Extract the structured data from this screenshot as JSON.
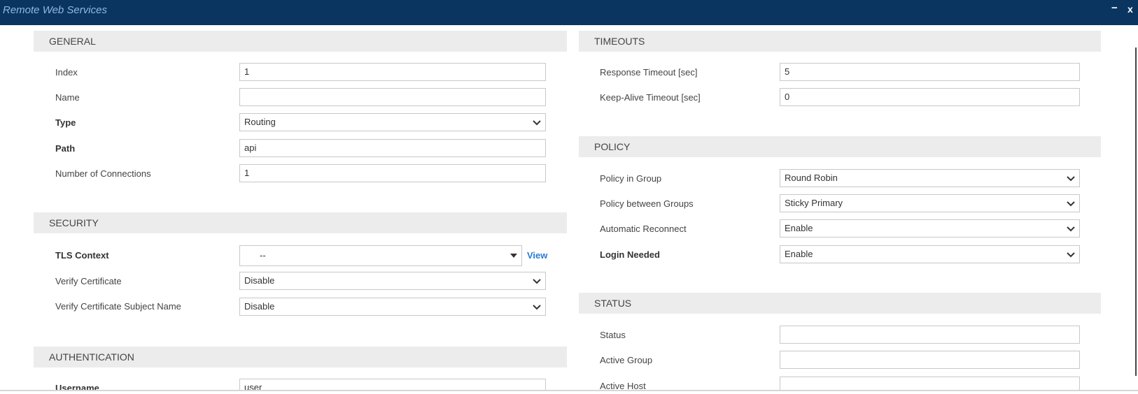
{
  "window": {
    "title": "Remote Web Services",
    "minimize": "−",
    "close": "x"
  },
  "general": {
    "header": "GENERAL",
    "index_label": "Index",
    "index_value": "1",
    "name_label": "Name",
    "name_value": "",
    "type_label": "Type",
    "type_value": "Routing",
    "path_label": "Path",
    "path_value": "api",
    "connections_label": "Number of Connections",
    "connections_value": "1"
  },
  "security": {
    "header": "SECURITY",
    "tls_label": "TLS Context",
    "tls_value": "--",
    "view_link": "View",
    "verify_cert_label": "Verify Certificate",
    "verify_cert_value": "Disable",
    "verify_subject_label": "Verify Certificate Subject Name",
    "verify_subject_value": "Disable"
  },
  "authentication": {
    "header": "AUTHENTICATION",
    "username_label": "Username",
    "username_value": "user"
  },
  "timeouts": {
    "header": "TIMEOUTS",
    "response_label": "Response Timeout [sec]",
    "response_value": "5",
    "keepalive_label": "Keep-Alive Timeout [sec]",
    "keepalive_value": "0"
  },
  "policy": {
    "header": "POLICY",
    "in_group_label": "Policy in Group",
    "in_group_value": "Round Robin",
    "between_groups_label": "Policy between Groups",
    "between_groups_value": "Sticky Primary",
    "auto_reconnect_label": "Automatic Reconnect",
    "auto_reconnect_value": "Enable",
    "login_needed_label": "Login Needed",
    "login_needed_value": "Enable"
  },
  "status": {
    "header": "STATUS",
    "status_label": "Status",
    "status_value": "",
    "active_group_label": "Active Group",
    "active_group_value": "",
    "active_host_label": "Active Host",
    "active_host_value": ""
  }
}
